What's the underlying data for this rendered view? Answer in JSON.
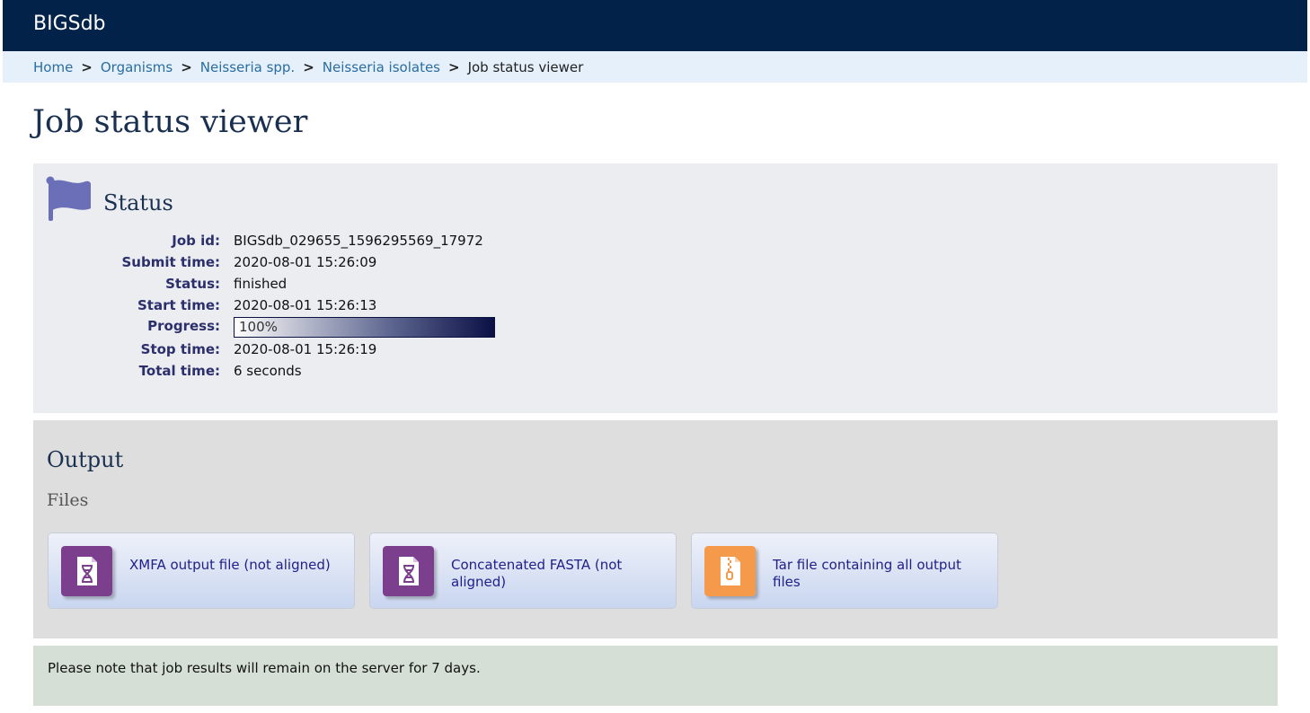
{
  "header": {
    "brand": "BIGSdb"
  },
  "breadcrumb": {
    "items": [
      "Home",
      "Organisms",
      "Neisseria spp.",
      "Neisseria isolates"
    ],
    "current": "Job status viewer",
    "separator": ">"
  },
  "page": {
    "title": "Job status viewer"
  },
  "status": {
    "heading": "Status",
    "icon": "flag-icon",
    "fields": {
      "job_id": {
        "label": "Job id:",
        "value": "BIGSdb_029655_1596295569_17972"
      },
      "submit_time": {
        "label": "Submit time:",
        "value": "2020-08-01 15:26:09"
      },
      "status": {
        "label": "Status:",
        "value": "finished"
      },
      "start_time": {
        "label": "Start time:",
        "value": "2020-08-01 15:26:13"
      },
      "progress": {
        "label": "Progress:",
        "value": "100%",
        "fraction": 1.0
      },
      "stop_time": {
        "label": "Stop time:",
        "value": "2020-08-01 15:26:19"
      },
      "total_time": {
        "label": "Total time:",
        "value": "6 seconds"
      }
    }
  },
  "output": {
    "heading": "Output",
    "subheading": "Files",
    "files": [
      {
        "label": "XMFA output file (not aligned)",
        "icon": "dna-file-icon",
        "icon_color": "#7b3f8e"
      },
      {
        "label": "Concatenated FASTA (not aligned)",
        "icon": "dna-file-icon",
        "icon_color": "#7b3f8e"
      },
      {
        "label": "Tar file containing all output files",
        "icon": "archive-file-icon",
        "icon_color": "#f5994a"
      }
    ]
  },
  "notice": {
    "text": "Please note that job results will remain on the server for 7 days."
  },
  "colors": {
    "topbar": "#03224a",
    "breadcrumb_bg": "#e6f0fb",
    "status_bg": "#ebedf1",
    "output_bg": "#dedede",
    "notice_bg": "#d5dfd5",
    "flag": "#6b6fb8"
  }
}
